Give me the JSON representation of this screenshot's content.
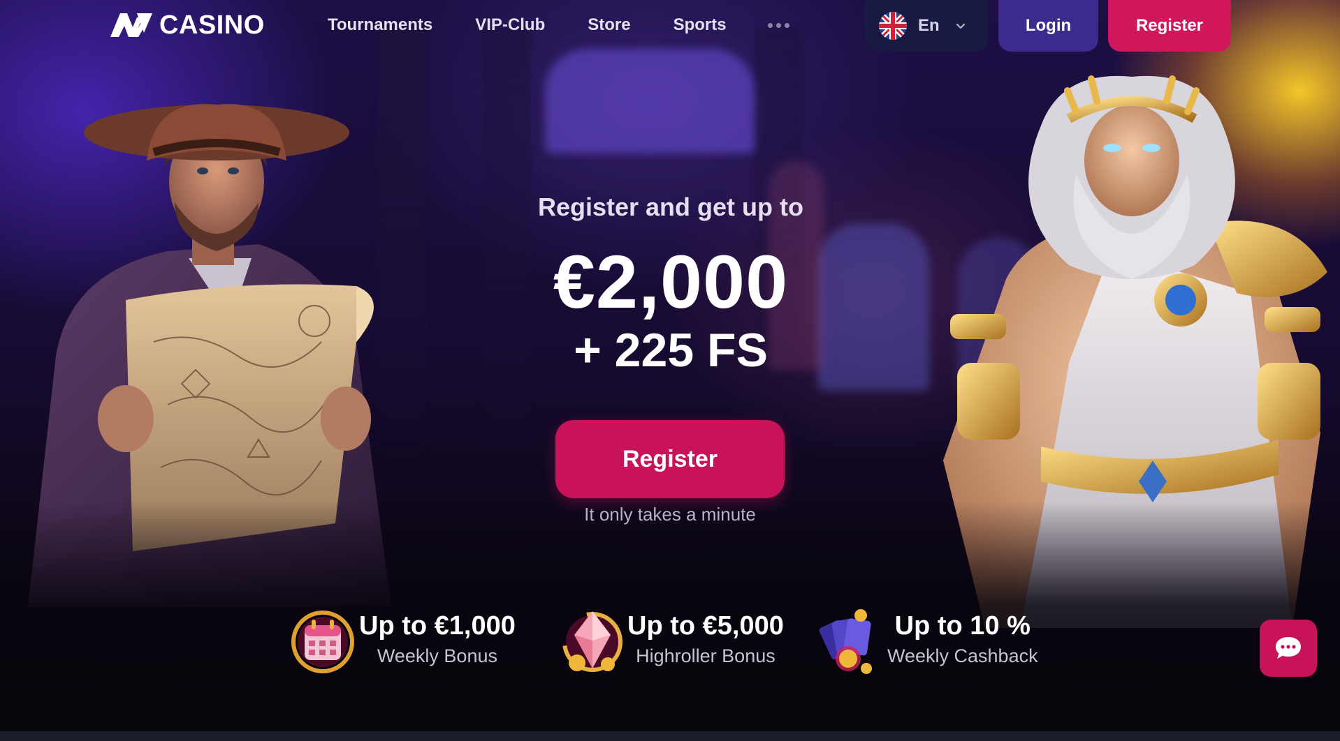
{
  "header": {
    "logo_text": "CASINO",
    "nav": [
      "Tournaments",
      "VIP-Club",
      "Store",
      "Sports"
    ],
    "more_icon": "more-dots-icon",
    "language": {
      "flag": "uk-flag-icon",
      "label": "En"
    },
    "login_label": "Login",
    "register_label": "Register"
  },
  "hero": {
    "subtitle": "Register and get up to",
    "amount": "€2,000",
    "free_spins": "+ 225 FS",
    "cta_label": "Register",
    "note": "It only takes a minute"
  },
  "promos": [
    {
      "icon": "calendar-icon",
      "title": "Up to €1,000",
      "subtitle": "Weekly Bonus"
    },
    {
      "icon": "crystal-icon",
      "title": "Up to €5,000",
      "subtitle": "Highroller Bonus"
    },
    {
      "icon": "cards-coin-icon",
      "title": "Up to 10 %",
      "subtitle": "Weekly Cashback"
    }
  ],
  "chat": {
    "icon": "chat-bubble-icon"
  },
  "colors": {
    "accent_pink": "#c8125a",
    "login_purple": "#3c2b8f",
    "lang_bg": "#181c42"
  }
}
